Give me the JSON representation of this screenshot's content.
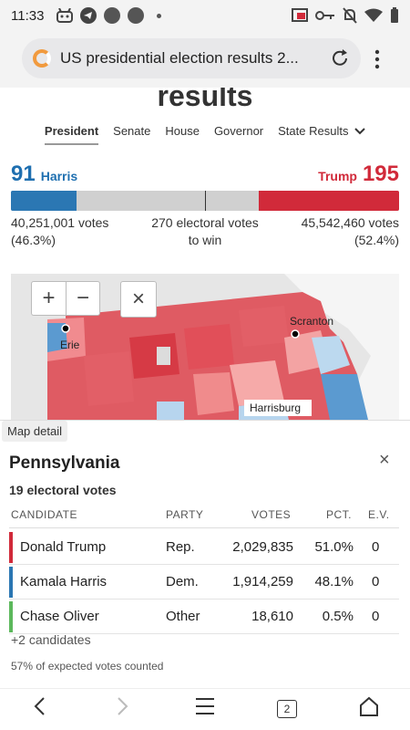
{
  "status_bar": {
    "time": "11:33",
    "left_icons": [
      "robot-icon",
      "telegram-icon",
      "circle-icon",
      "circle-icon",
      "dot-icon"
    ],
    "right_icons": [
      "cast-icon",
      "key-icon",
      "bell-off-icon",
      "wifi-icon",
      "battery-icon"
    ]
  },
  "browser": {
    "url_text": "US presidential election results 2...",
    "reload_icon": "reload-icon",
    "menu_icon": "kebab-menu-icon"
  },
  "page": {
    "heading": "results",
    "tabs": [
      {
        "label": "President",
        "active": true
      },
      {
        "label": "Senate",
        "active": false
      },
      {
        "label": "House",
        "active": false
      },
      {
        "label": "Governor",
        "active": false
      },
      {
        "label": "State Results",
        "active": false
      }
    ],
    "state_results_chevron": "chevron-down-icon"
  },
  "tally": {
    "harris_ev": "91",
    "harris_name": "Harris",
    "trump_name": "Trump",
    "trump_ev": "195",
    "harris_fraction": 0.1684,
    "trump_fraction": 0.3605,
    "harris_votes": "40,251,001 votes",
    "harris_pct": "(46.3%)",
    "threshold_line1": "270 electoral votes",
    "threshold_line2": "to win",
    "trump_votes": "45,542,460 votes",
    "trump_pct": "(52.4%)",
    "colors": {
      "harris": "#2b77b3",
      "trump": "#d12a3a",
      "uncalled": "#d0d0d0"
    }
  },
  "map": {
    "zoom_in": "+",
    "zoom_out": "−",
    "close": "×",
    "cities": [
      "Erie",
      "Scranton",
      "Harrisburg"
    ]
  },
  "detail": {
    "tag": "Map detail",
    "state": "Pennsylvania",
    "electoral_votes": "19 electoral votes",
    "close": "×",
    "columns": [
      "CANDIDATE",
      "PARTY",
      "VOTES",
      "PCT.",
      "E.V."
    ],
    "rows": [
      {
        "candidate": "Donald Trump",
        "party": "Rep.",
        "votes": "2,029,835",
        "pct": "51.0%",
        "ev": "0",
        "color": "#d12a3a"
      },
      {
        "candidate": "Kamala Harris",
        "party": "Dem.",
        "votes": "1,914,259",
        "pct": "48.1%",
        "ev": "0",
        "color": "#2b77b3"
      },
      {
        "candidate": "Chase Oliver",
        "party": "Other",
        "votes": "18,610",
        "pct": "0.5%",
        "ev": "0",
        "color": "#5cb85c"
      }
    ],
    "more_candidates": "+2 candidates",
    "counted": "57% of expected votes counted"
  },
  "nav_bar": {
    "tab_count": "2"
  }
}
